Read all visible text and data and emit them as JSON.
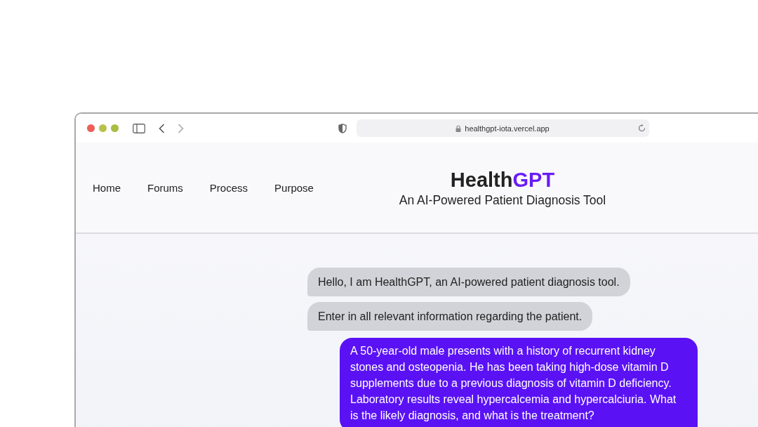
{
  "browser": {
    "url": "healthgpt-iota.vercel.app"
  },
  "nav": [
    {
      "label": "Home"
    },
    {
      "label": "Forums"
    },
    {
      "label": "Process"
    },
    {
      "label": "Purpose"
    }
  ],
  "brand": {
    "title_main": "Health",
    "title_accent": "GPT",
    "subtitle": "An AI-Powered Patient Diagnosis Tool"
  },
  "messages": [
    {
      "kind": "bot",
      "text": "Hello, I am HealthGPT, an AI-powered patient diagnosis tool."
    },
    {
      "kind": "bot",
      "text": "Enter in all relevant information regarding the patient."
    },
    {
      "kind": "user",
      "text": "A 50-year-old male presents with a history of recurrent kidney stones and osteopenia. He has been taking high-dose vitamin D supplements due to a previous diagnosis of vitamin D deficiency. Laboratory results reveal hypercalcemia and hypercalciuria. What is the likely diagnosis, and what is the treatment?"
    }
  ]
}
